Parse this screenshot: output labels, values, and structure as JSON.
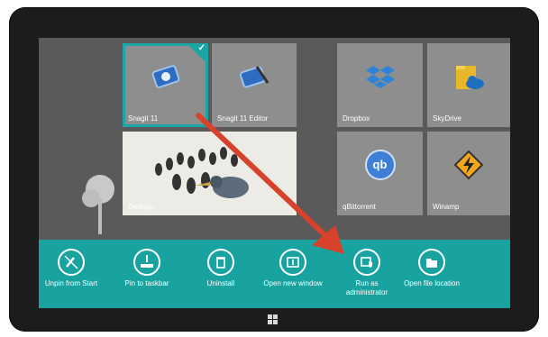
{
  "tiles": {
    "snagit": {
      "label": "Snagit 11"
    },
    "snagit_editor": {
      "label": "Snagit 11 Editor"
    },
    "dropbox": {
      "label": "Dropbox"
    },
    "skydrive": {
      "label": "SkyDrive"
    },
    "desktop": {
      "label": "Desktop"
    },
    "qbittorrent": {
      "label": "qBittorrent",
      "icon_text": "qb"
    },
    "winamp": {
      "label": "Winamp"
    }
  },
  "appbar": {
    "unpin": "Unpin from Start",
    "pin_taskbar": "Pin to taskbar",
    "uninstall": "Uninstall",
    "open_new_window": "Open new window",
    "run_admin": "Run as administrator",
    "open_file_location": "Open file location"
  },
  "colors": {
    "accent": "#18a3a0",
    "arrow": "#d6422a"
  },
  "icons": [
    "unpin-icon",
    "pin-taskbar-icon",
    "trash-icon",
    "new-window-icon",
    "shield-icon",
    "folder-icon",
    "windows-logo-icon"
  ]
}
